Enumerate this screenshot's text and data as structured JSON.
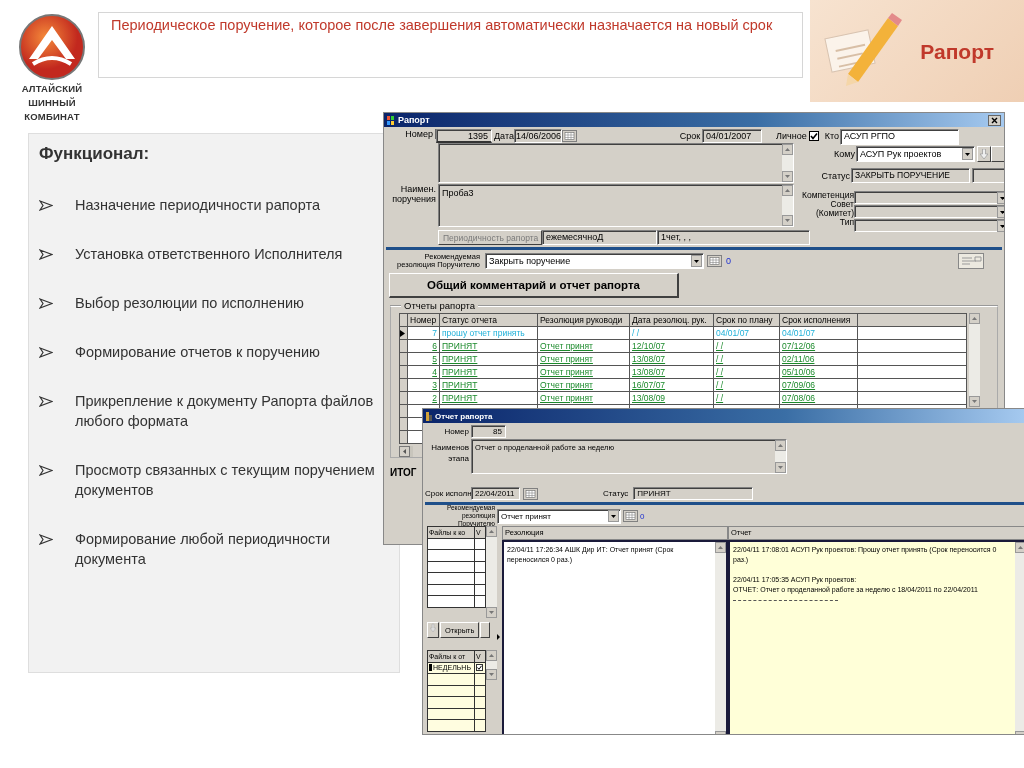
{
  "logo": {
    "lines": [
      "АЛТАЙСКИЙ",
      "ШИННЫЙ",
      "КОМБИНАТ"
    ]
  },
  "slide_title": "Периодическое поручение, которое после завершения автоматически назначается на новый срок",
  "badge": "Рапорт",
  "features": {
    "heading": "Функционал:",
    "items": [
      "Назначение периодичности рапорта",
      "Установка ответственного Исполнителя",
      "Выбор резолюции по исполнению",
      "Формирование отчетов к поручению",
      "Прикрепление к документу Рапорта файлов любого формата",
      "Просмотр связанных с текущим поручением документов",
      "Формирование любой периодичности документа"
    ]
  },
  "report_window": {
    "title": "Рапорт",
    "number_label": "Номер",
    "number": "1395",
    "date_label": "Дата",
    "date": "14/06/2006",
    "deadline_label": "Срок",
    "deadline": "04/01/2007",
    "personal_label": "Личное",
    "personal_checked": true,
    "from_label": "Кто",
    "from": "АСУП РГПО",
    "to_label": "Кому",
    "to": "АСУП Рук проектов",
    "status_label": "Статус",
    "status": "ЗАКРЫТЬ ПОРУЧЕНИЕ",
    "name_label": "Наимен. поручения",
    "name": "Проба3",
    "side_labels": [
      "Компетенция",
      "Совет (Комитет)",
      "Тип"
    ],
    "periodicity_button": "Периодичность рапорта",
    "periodicity": "ежемесячноД",
    "period_detail": "1чет, , ,",
    "recommend_label": "Рекомендуемая резолюция Поручителю",
    "recommend": "Закрыть поручение",
    "recommend_count": "0",
    "comment_button": "Общий комментарий и отчет рапорта",
    "reports": {
      "legend": "Отчеты рапорта",
      "columns": [
        "Номер",
        "Статус отчета",
        "Резолюция руководи",
        "Дата резолюц. рук.",
        "Срок по плану",
        "Срок исполнения"
      ],
      "rows": [
        {
          "number": "7",
          "status": "прошу отчет принять",
          "resolution": "",
          "resolution_date": "/ /",
          "plan": "04/01/07",
          "done": "04/01/07",
          "kind": "open",
          "selected": true
        },
        {
          "number": "6",
          "status": "ПРИНЯТ",
          "resolution": "Отчет принят",
          "resolution_date": "12/10/07",
          "plan": "/ /",
          "done": "07/12/06",
          "kind": "accepted",
          "selected": false
        },
        {
          "number": "5",
          "status": "ПРИНЯТ",
          "resolution": "Отчет принят",
          "resolution_date": "13/08/07",
          "plan": "/ /",
          "done": "02/11/06",
          "kind": "accepted",
          "selected": false
        },
        {
          "number": "4",
          "status": "ПРИНЯТ",
          "resolution": "Отчет принят",
          "resolution_date": "13/08/07",
          "plan": "/ /",
          "done": "05/10/06",
          "kind": "accepted",
          "selected": false
        },
        {
          "number": "3",
          "status": "ПРИНЯТ",
          "resolution": "Отчет принят",
          "resolution_date": "16/07/07",
          "plan": "/ /",
          "done": "07/09/06",
          "kind": "accepted",
          "selected": false
        },
        {
          "number": "2",
          "status": "ПРИНЯТ",
          "resolution": "Отчет принят",
          "resolution_date": "13/08/09",
          "plan": "/ /",
          "done": "07/08/06",
          "kind": "accepted",
          "selected": false
        }
      ]
    },
    "total_label": "ИТОГ"
  },
  "stage_window": {
    "title": "Отчет рапорта",
    "number_label": "Номер",
    "number": "85",
    "name_label": "Наименов этапа",
    "name": "Отчет о проделанной работе за неделю",
    "deadline_label": "Срок исполн.",
    "deadline": "22/04/2011",
    "status_label": "Статус",
    "status": "ПРИНЯТ",
    "recommend_label": "Рекомендуемая резолюция Поручителю",
    "recommend": "Отчет принят",
    "recommend_count": "0",
    "task_files": {
      "columns": [
        "Файлы к ко",
        "V"
      ]
    },
    "open_button": "Открыть",
    "report_files": {
      "columns": [
        "Файлы к от",
        "V"
      ],
      "rows": [
        {
          "name": "НЕДЕЛЬНЬ",
          "checked": true,
          "selected": true
        }
      ]
    },
    "resolution": {
      "header": "Резолюция",
      "text": "22/04/11 17:26:34   АШК Дир ИТ: Отчет принят (Срок переносился 0 раз.)"
    },
    "report": {
      "header": "Отчет",
      "entries": [
        "22/04/11 17:08:01   АСУП Рук проектов: Прошу отчет принять (Срок переносится 0 раз.)",
        "22/04/11 17:05:35   АСУП Рук проектов:\nОТЧЕТ: Отчет о проделанной работе за неделю с 18/04/2011 по 22/04/2011"
      ]
    }
  }
}
